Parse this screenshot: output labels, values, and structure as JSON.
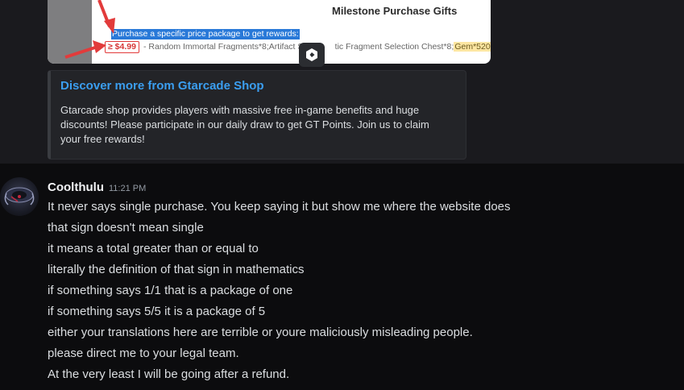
{
  "embedded_image": {
    "title": "Milestone Purchase Gifts",
    "highlight_text": "Purchase a specific price package to get rewards:",
    "price": "≥ $4.99",
    "description": "- Random Immortal Fragments*8;Artifact Sc",
    "description_tail": "tic Fragment Selection Chest*8;",
    "gem": "Gem*520"
  },
  "link_embed": {
    "title": "Discover more from Gtarcade Shop",
    "description": "Gtarcade shop provides players with massive free in-game benefits and huge discounts! Please participate in our daily draw to get GT Points. Join us to claim your free rewards!"
  },
  "message": {
    "author": "Coolthulu",
    "timestamp": "11:21 PM",
    "lines": [
      "It never says single purchase. You keep saying it but show me where the website does",
      "that sign doesn't mean single",
      "it means a total greater than or equal to",
      "literally the definition of that sign in mathematics",
      "if something says 1/1 that is a package of one",
      "if something says 5/5 it is a package of 5",
      "either your translations here are terrible or youre maliciously misleading people.",
      "please direct me to your legal team.",
      "At the very least I will be going after a refund."
    ]
  },
  "colors": {
    "link": "#3b9ef0",
    "highlight": "#2979d8",
    "annotation_red": "#e23b3b"
  }
}
